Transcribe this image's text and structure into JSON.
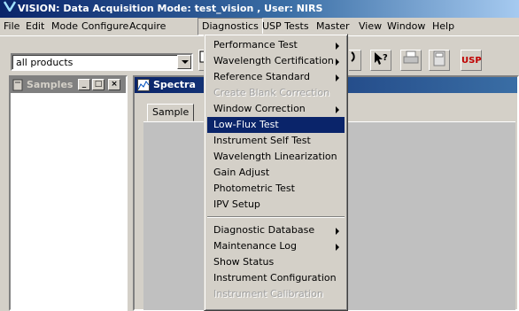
{
  "window": {
    "title": "VISION: Data Acquisition Mode: test_vision , User: NIRS"
  },
  "menubar": [
    "File",
    "Edit",
    "Mode",
    "Configure",
    "Acquire",
    "Diagnostics",
    "USP Tests",
    "Master",
    "View",
    "Window",
    "Help"
  ],
  "toolbar": {
    "product_select": "all products",
    "usp_label": "USP"
  },
  "samples_panel": {
    "title": "Samples"
  },
  "spectra_panel": {
    "title": "Spectra",
    "tab": "Sample"
  },
  "diagnostics_menu": {
    "items": [
      {
        "label": "Performance Test",
        "submenu": true
      },
      {
        "label": "Wavelength Certification",
        "submenu": true
      },
      {
        "label": "Reference Standard",
        "submenu": true
      },
      {
        "label": "Create Blank Correction",
        "disabled": true
      },
      {
        "label": "Window Correction",
        "submenu": true
      },
      {
        "label": "Low-Flux Test",
        "highlighted": true
      },
      {
        "label": "Instrument Self Test"
      },
      {
        "label": "Wavelength Linearization"
      },
      {
        "label": "Gain Adjust"
      },
      {
        "label": "Photometric Test"
      },
      {
        "label": "IPV Setup"
      },
      {
        "label": "Diagnostic Database",
        "submenu": true
      },
      {
        "label": "Maintenance Log",
        "submenu": true
      },
      {
        "label": "Show Status"
      },
      {
        "label": "Instrument Configuration"
      },
      {
        "label": "Instrument Calibration",
        "disabled": true
      }
    ]
  }
}
